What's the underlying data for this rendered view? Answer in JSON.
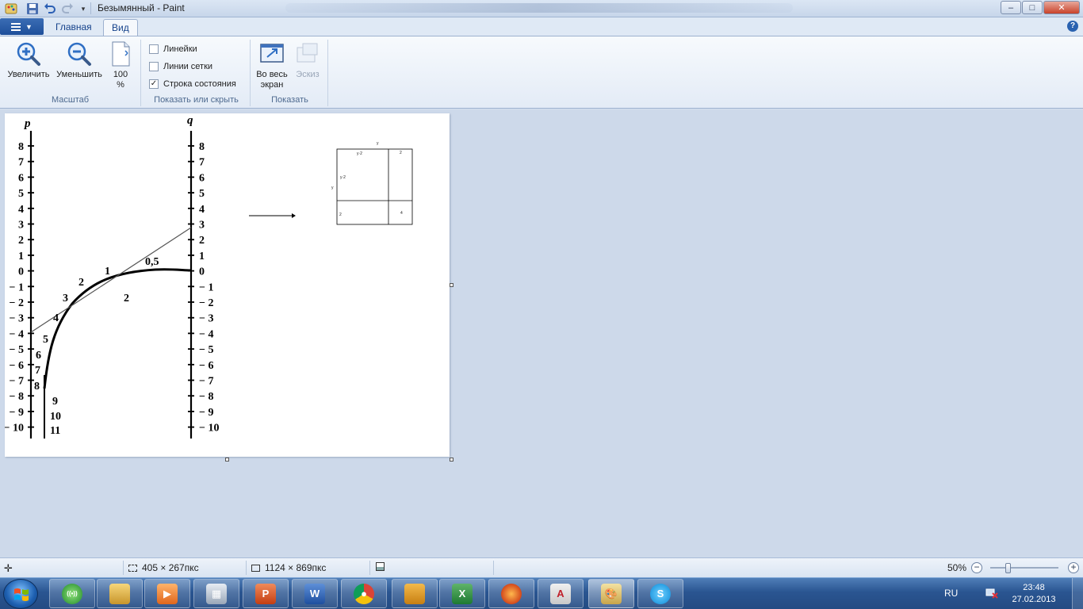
{
  "window": {
    "title": "Безымянный - Paint",
    "controls": {
      "minimize": "–",
      "maximize": "□",
      "close": "✕"
    }
  },
  "quick_access": {
    "icons": [
      "paint-app-icon",
      "save-icon",
      "undo-icon",
      "redo-icon",
      "customize-dropdown-icon"
    ]
  },
  "ribbon": {
    "tabs": [
      {
        "label": "Главная",
        "active": false
      },
      {
        "label": "Вид",
        "active": true
      }
    ],
    "zoom_group": {
      "label": "Масштаб",
      "zoom_in": "Увеличить",
      "zoom_out": "Уменьшить",
      "actual_size_line1": "100",
      "actual_size_line2": "%"
    },
    "show_hide_group": {
      "label": "Показать или скрыть",
      "checkboxes": [
        {
          "label": "Линейки",
          "checked": false
        },
        {
          "label": "Линии сетки",
          "checked": false
        },
        {
          "label": "Строка состояния",
          "checked": true
        }
      ]
    },
    "display_group": {
      "label": "Показать",
      "fullscreen_line1": "Во весь",
      "fullscreen_line2": "экран",
      "thumbnail": "Эскиз",
      "thumbnail_enabled": false
    }
  },
  "canvas": {
    "nomogram": {
      "left_axis_label": "p",
      "right_axis_label": "q",
      "left_ticks": [
        "8",
        "7",
        "6",
        "5",
        "4",
        "3",
        "2",
        "1",
        "0",
        "− 1",
        "− 2",
        "− 3",
        "− 4",
        "− 5",
        "− 6",
        "− 7",
        "− 8",
        "− 9",
        "− 10"
      ],
      "right_ticks": [
        "8",
        "7",
        "6",
        "5",
        "4",
        "3",
        "2",
        "1",
        "0",
        "− 1",
        "− 2",
        "− 3",
        "− 4",
        "− 5",
        "− 6",
        "− 7",
        "− 8",
        "− 9",
        "− 10"
      ],
      "curve_labels": [
        "0,5",
        "1",
        "2",
        "3",
        "4",
        "5",
        "6",
        "7",
        "8",
        "9",
        "10",
        "11"
      ],
      "extra_label": "2"
    },
    "mini_diagram": {
      "top_label": "y",
      "side_label": "y",
      "cell_labels": [
        "y·2",
        "2",
        "y·2",
        "2",
        "4"
      ]
    }
  },
  "status_bar": {
    "cursor_position": "",
    "selection_size": "405 × 267пкс",
    "image_size": "1124 × 869пкс",
    "zoom_percent": "50%",
    "zoom_fraction": 0.5
  },
  "taskbar": {
    "apps": [
      "network-icon",
      "explorer-icon",
      "media-player-icon",
      "calculator-icon",
      "powerpoint-icon",
      "word-icon",
      "chrome-icon",
      "notebook-icon",
      "excel-icon",
      "firefox-icon",
      "acrobat-icon",
      "paint-icon",
      "skype-icon"
    ],
    "language": "RU",
    "time": "23:48",
    "date": "27.02.2013"
  },
  "colors": {
    "accent": "#1e4f9a",
    "ribbon_bg": "#e3ebf6",
    "workspace_bg": "#cdd9ea"
  }
}
